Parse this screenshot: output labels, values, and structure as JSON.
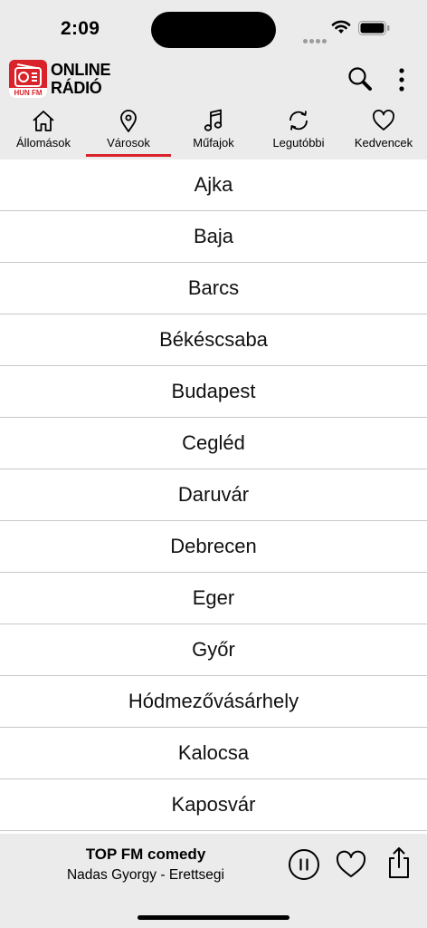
{
  "status": {
    "time": "2:09"
  },
  "app": {
    "logo_line1": "ONLINE",
    "logo_line2": "RÁDIÓ",
    "logo_badge": "HUN FM",
    "accent_color": "#d9222a"
  },
  "tabs": [
    {
      "label": "Állomások",
      "icon": "home-icon"
    },
    {
      "label": "Városok",
      "icon": "location-pin-icon",
      "active": true
    },
    {
      "label": "Műfajok",
      "icon": "music-note-icon"
    },
    {
      "label": "Legutóbbi",
      "icon": "refresh-icon"
    },
    {
      "label": "Kedvencek",
      "icon": "heart-icon"
    }
  ],
  "cities": [
    "Ajka",
    "Baja",
    "Barcs",
    "Békéscsaba",
    "Budapest",
    "Cegléd",
    "Daruvár",
    "Debrecen",
    "Eger",
    "Győr",
    "Hódmezővásárhely",
    "Kalocsa",
    "Kaposvár"
  ],
  "player": {
    "station": "TOP FM comedy",
    "track": "Nadas Gyorgy - Erettsegi"
  }
}
